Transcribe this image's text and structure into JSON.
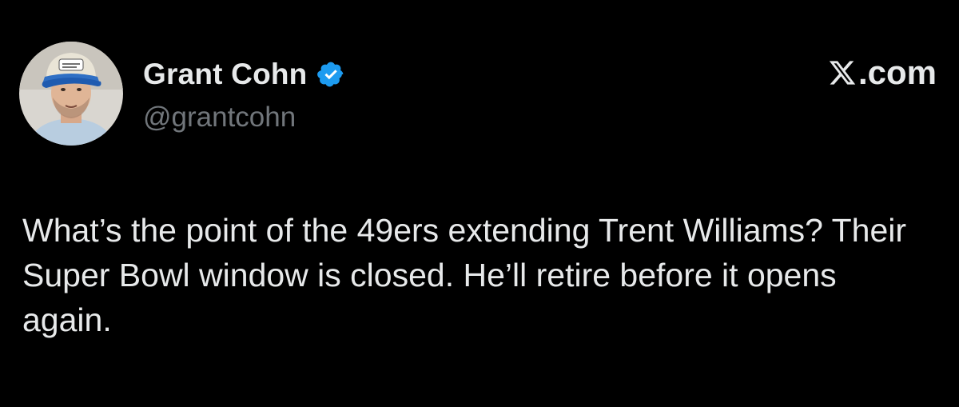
{
  "author": {
    "display_name": "Grant Cohn",
    "handle": "@grantcohn",
    "verified": true,
    "avatar": "profile-photo-man-in-blue-cap"
  },
  "brand": {
    "logo": "x-logo-icon",
    "text": ".com"
  },
  "tweet": {
    "text": "What’s the point of the 49ers extending Trent Williams? Their Super Bowl window is closed. He’ll retire before it opens again."
  },
  "colors": {
    "background": "#000000",
    "text_primary": "#e7e9ea",
    "text_secondary": "#71767b",
    "verified_badge": "#1d9bf0"
  }
}
